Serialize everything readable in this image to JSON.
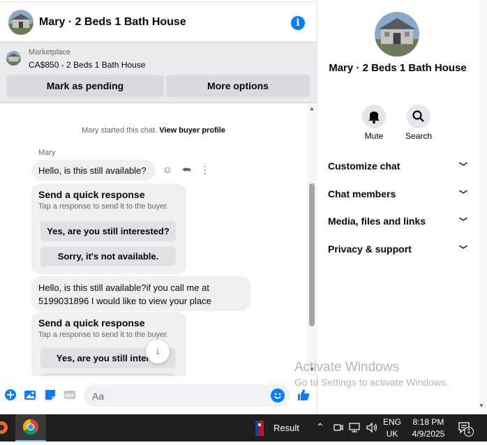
{
  "chat": {
    "title": "Mary · 2 Beds 1 Bath House",
    "marketplace_label": "Marketplace",
    "listing": "CA$850 - 2 Beds 1 Bath House",
    "mark_pending": "Mark as pending",
    "more_options": "More options"
  },
  "messages": {
    "system_note": "Mary started this chat.",
    "view_profile": "View buyer profile",
    "sender": "Mary",
    "msg1": "Hello, is this still available?",
    "msg2": "Hello, is this still available?if you call me at 5199031896 I would like to view your place",
    "quick_response": {
      "title": "Send a quick response",
      "subtitle": "Tap a response to send it to the buyer.",
      "option1": "Yes, are you still interested?",
      "option2": "Sorry, it's not available.",
      "option1_truncated": "Yes, are you still interes"
    }
  },
  "composer": {
    "placeholder": "Aa"
  },
  "panel": {
    "title": "Mary · 2 Beds 1 Bath House",
    "mute": "Mute",
    "search": "Search",
    "sections": [
      "Customize chat",
      "Chat members",
      "Media, files and links",
      "Privacy & support"
    ]
  },
  "watermark": {
    "line1": "Activate Windows",
    "line2": "Go to Settings to activate Windows."
  },
  "taskbar": {
    "result_label": "Result",
    "lang_top": "ENG",
    "lang_bottom": "UK",
    "time": "8:18 PM",
    "date": "4/9/2025",
    "notif_count": "1"
  },
  "colors": {
    "accent": "#0a7cff",
    "bubble": "#f0f0f0",
    "market_bg": "#e9eaec"
  }
}
